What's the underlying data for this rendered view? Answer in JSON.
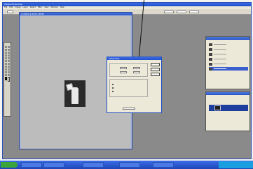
{
  "app": {
    "title": "Adobe Photoshop",
    "menu": [
      "File",
      "Edit",
      "Image",
      "Layer",
      "Select",
      "Filter",
      "View",
      "Window",
      "Help"
    ]
  },
  "document": {
    "title": "Untitled @ 100% (RGB)"
  },
  "dialog": {
    "title": "Image Size",
    "buttons": [
      "OK",
      "Cancel",
      "Auto..."
    ]
  },
  "taskbar": {
    "items": [
      "",
      "",
      "",
      "",
      ""
    ]
  }
}
